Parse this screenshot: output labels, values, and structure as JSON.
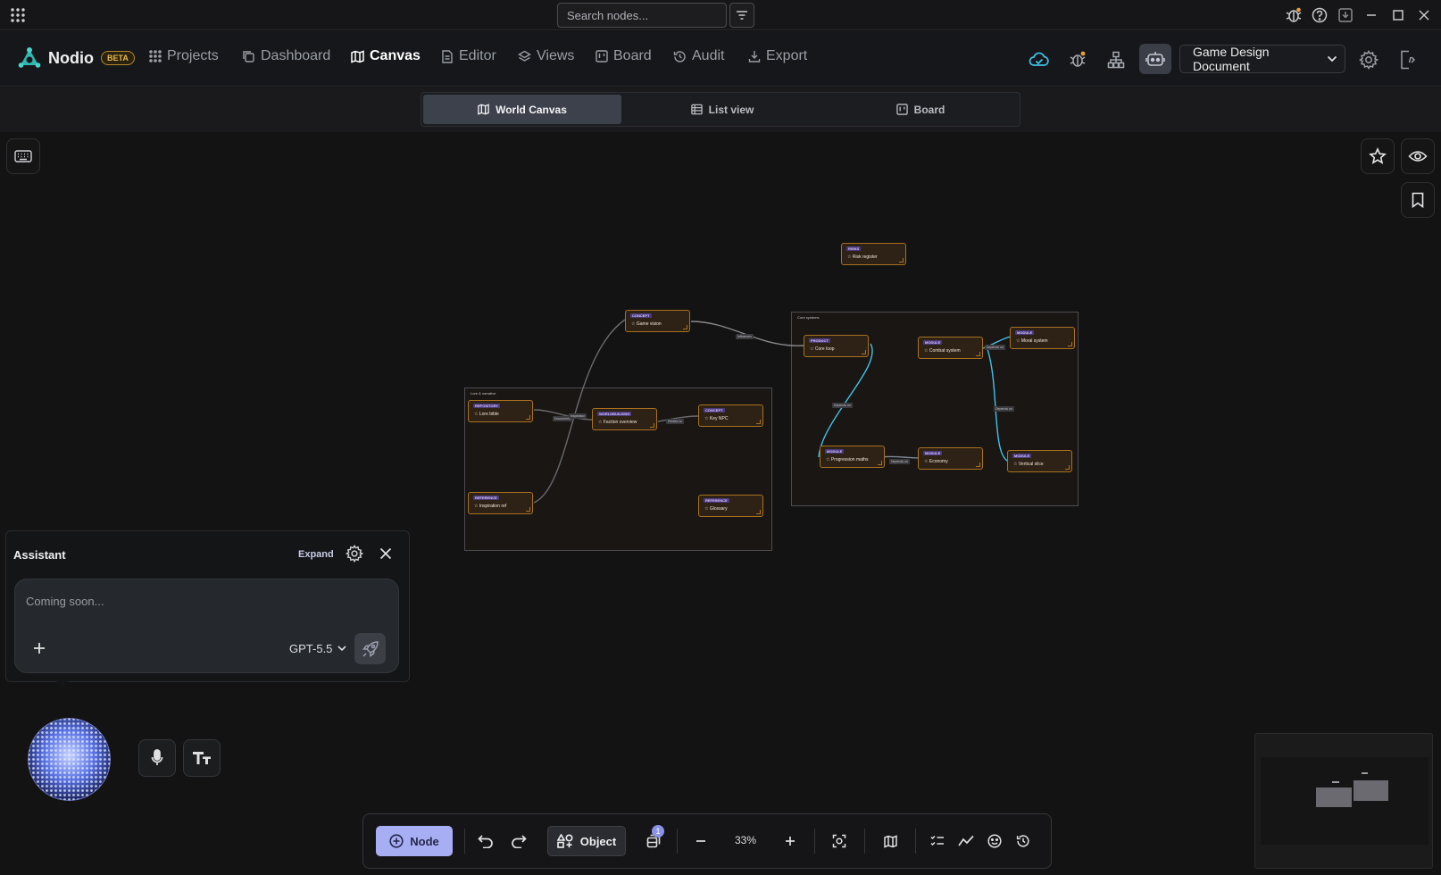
{
  "titlebar": {
    "search_placeholder": "Search nodes...",
    "icons": [
      "apps-grid-icon",
      "filter-icon",
      "bug-icon",
      "help-icon",
      "download-icon",
      "minimize-icon",
      "maximize-icon",
      "close-icon"
    ]
  },
  "header": {
    "brand_name": "Nodio",
    "beta_label": "BETA",
    "nav": [
      {
        "label": "Projects",
        "icon": "grid-dots-icon"
      },
      {
        "label": "Dashboard",
        "icon": "copy-icon"
      },
      {
        "label": "Canvas",
        "icon": "map-icon",
        "active": true
      },
      {
        "label": "Editor",
        "icon": "document-icon"
      },
      {
        "label": "Views",
        "icon": "layers-icon"
      },
      {
        "label": "Board",
        "icon": "kanban-icon"
      },
      {
        "label": "Audit",
        "icon": "history-icon"
      },
      {
        "label": "Export",
        "icon": "export-icon"
      }
    ],
    "document_selector": "Game Design Document",
    "accent_color": "#8b93e6"
  },
  "view_tabs": [
    {
      "label": "World Canvas",
      "icon": "map-icon",
      "active": true
    },
    {
      "label": "List view",
      "icon": "list-icon"
    },
    {
      "label": "Board",
      "icon": "kanban-icon"
    }
  ],
  "canvas": {
    "groups": [
      {
        "title": "Lore & narrative"
      },
      {
        "title": "Core systems"
      }
    ],
    "nodes": [
      {
        "tag": "RISKS",
        "title": "Risk register"
      },
      {
        "tag": "CONCEPT",
        "title": "Game vision"
      },
      {
        "tag": "REPOSITORY",
        "title": "Lore bible"
      },
      {
        "tag": "WORLDBUILDING",
        "title": "Faction overview"
      },
      {
        "tag": "CONCEPT",
        "title": "Key NPC"
      },
      {
        "tag": "REFERENCE",
        "title": "Inspiration ref"
      },
      {
        "tag": "REFERENCE",
        "title": "Glossary"
      },
      {
        "tag": "PRODUCT",
        "title": "Core loop"
      },
      {
        "tag": "MODULE",
        "title": "Combat system"
      },
      {
        "tag": "MODULE",
        "title": "Moral system"
      },
      {
        "tag": "MODULE",
        "title": "Progression maths"
      },
      {
        "tag": "MODULE",
        "title": "Economy"
      },
      {
        "tag": "MODULE",
        "title": "Vertical slice"
      }
    ],
    "edge_labels": [
      "Influences",
      "Documents",
      "Inspiration",
      "Relates to",
      "Depends on",
      "Depends on",
      "Depends on",
      "Depends on"
    ]
  },
  "assistant": {
    "title": "Assistant",
    "expand_label": "Expand",
    "input_placeholder": "Coming soon...",
    "model": "GPT-5.5"
  },
  "toolbar": {
    "node_label": "Node",
    "object_label": "Object",
    "layer_badge": "1",
    "zoom": "33%"
  }
}
